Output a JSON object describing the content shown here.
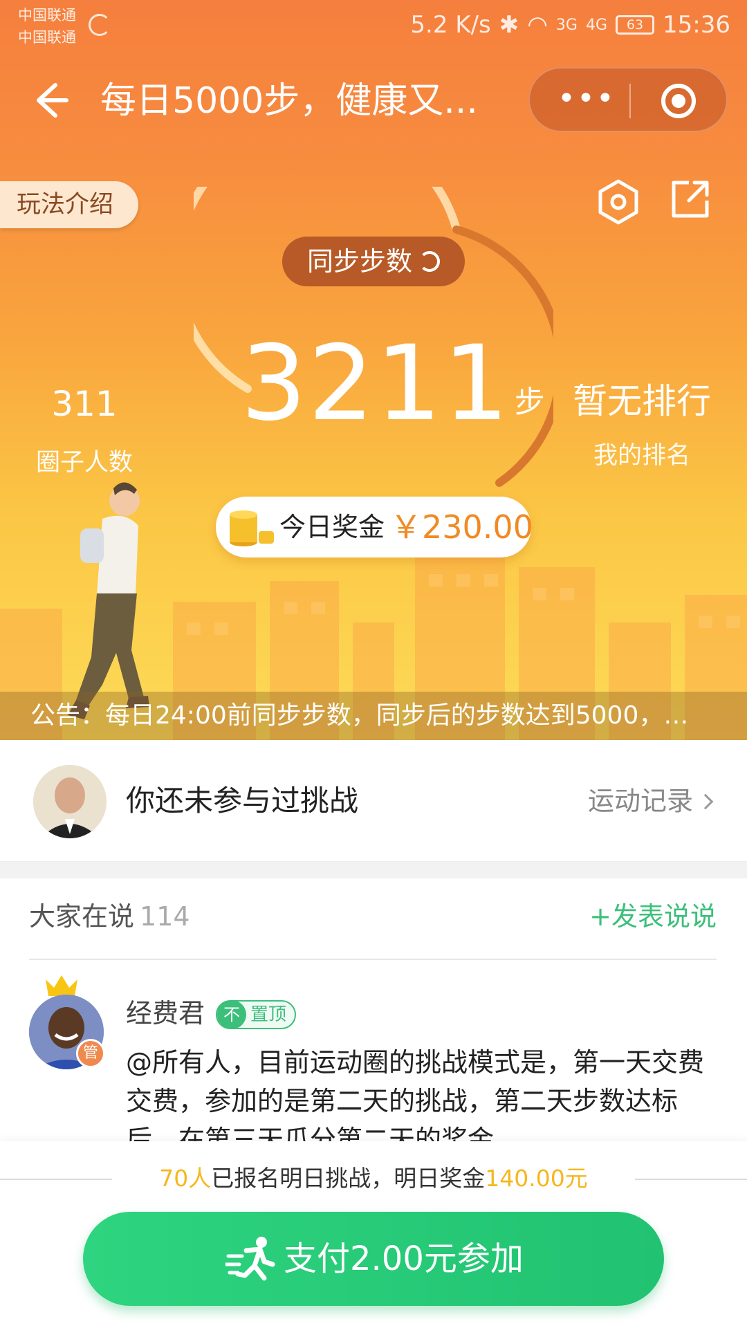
{
  "status_bar": {
    "carrier_1": "中国联通",
    "carrier_2": "中国联通",
    "speed": "5.2 K/s",
    "net_1": "3G",
    "net_2": "4G",
    "battery": "63",
    "time": "15:36"
  },
  "nav": {
    "title": "每日5000步，健康又...",
    "more_glyph": "•••"
  },
  "hero": {
    "intro_tab": "玩法介绍",
    "sync_label": "同步步数",
    "steps": "3211",
    "steps_unit": "步",
    "members_count": "311",
    "members_label": "圈子人数",
    "rank_value": "暂无排行",
    "rank_label": "我的排名",
    "bonus_label": "今日奖金",
    "bonus_amount": "￥230.00",
    "notice": "公告：每日24:00前同步步数，同步后的步数达到5000，…"
  },
  "user": {
    "status": "你还未参与过挑战",
    "records_link": "运动记录"
  },
  "comments": {
    "title": "大家在说",
    "count": "114",
    "post_link": "+发表说说",
    "post": {
      "author": "经费君",
      "admin_badge": "管",
      "pin_icon": "不",
      "pin_label": "置顶",
      "text": "@所有人，目前运动圈的挑战模式是，第一天交费交费，参加的是第二天的挑战，第二天步数达标后，在第三天瓜分第二天的奖金。"
    }
  },
  "bottom": {
    "signup_count": "70人",
    "signup_text": "已报名明日挑战，明日奖金",
    "tomorrow_bonus": "140.00元",
    "pay_button": "支付2.00元参加"
  },
  "icons": {
    "back": "back-arrow-icon",
    "hex": "hexagon-settings-icon",
    "share": "share-icon",
    "coins": "coins-icon",
    "crown": "crown-icon",
    "runner": "runner-icon"
  },
  "colors": {
    "accent_orange": "#f08a24",
    "accent_green": "#3cbf7b",
    "highlight_yellow": "#f5b71e"
  }
}
